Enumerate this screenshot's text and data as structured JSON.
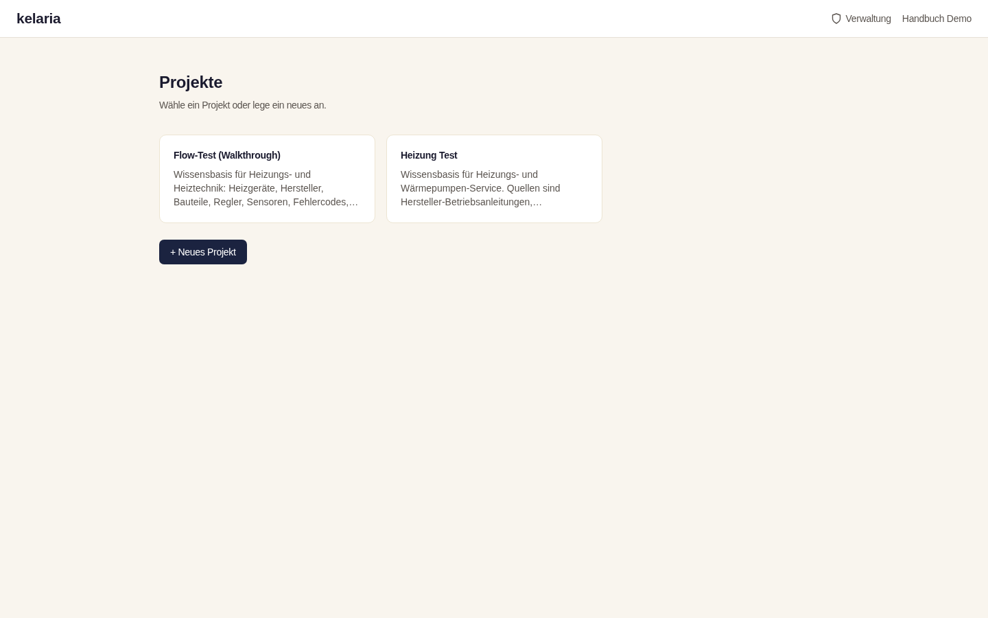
{
  "header": {
    "logo": "kelaria",
    "nav": [
      {
        "kind": "iconlink",
        "label": "Verwaltung"
      },
      {
        "kind": "plain",
        "label": "Handbuch Demo"
      }
    ]
  },
  "page": {
    "title": "Projekte",
    "subtitle": "Wähle ein Projekt oder lege ein neues an."
  },
  "projects": [
    {
      "title": "Flow-Test (Walkthrough)",
      "description": "Wissensbasis für Heizungs- und Heiztechnik: Heizgeräte, Hersteller, Bauteile, Regler, Sensoren, Fehlercodes,…"
    },
    {
      "title": "Heizung Test",
      "description": "Wissensbasis für Heizungs- und Wärmepumpen-Service. Quellen sind Hersteller-Betriebsanleitungen,…"
    }
  ],
  "new_project_button": "+ Neues Projekt"
}
